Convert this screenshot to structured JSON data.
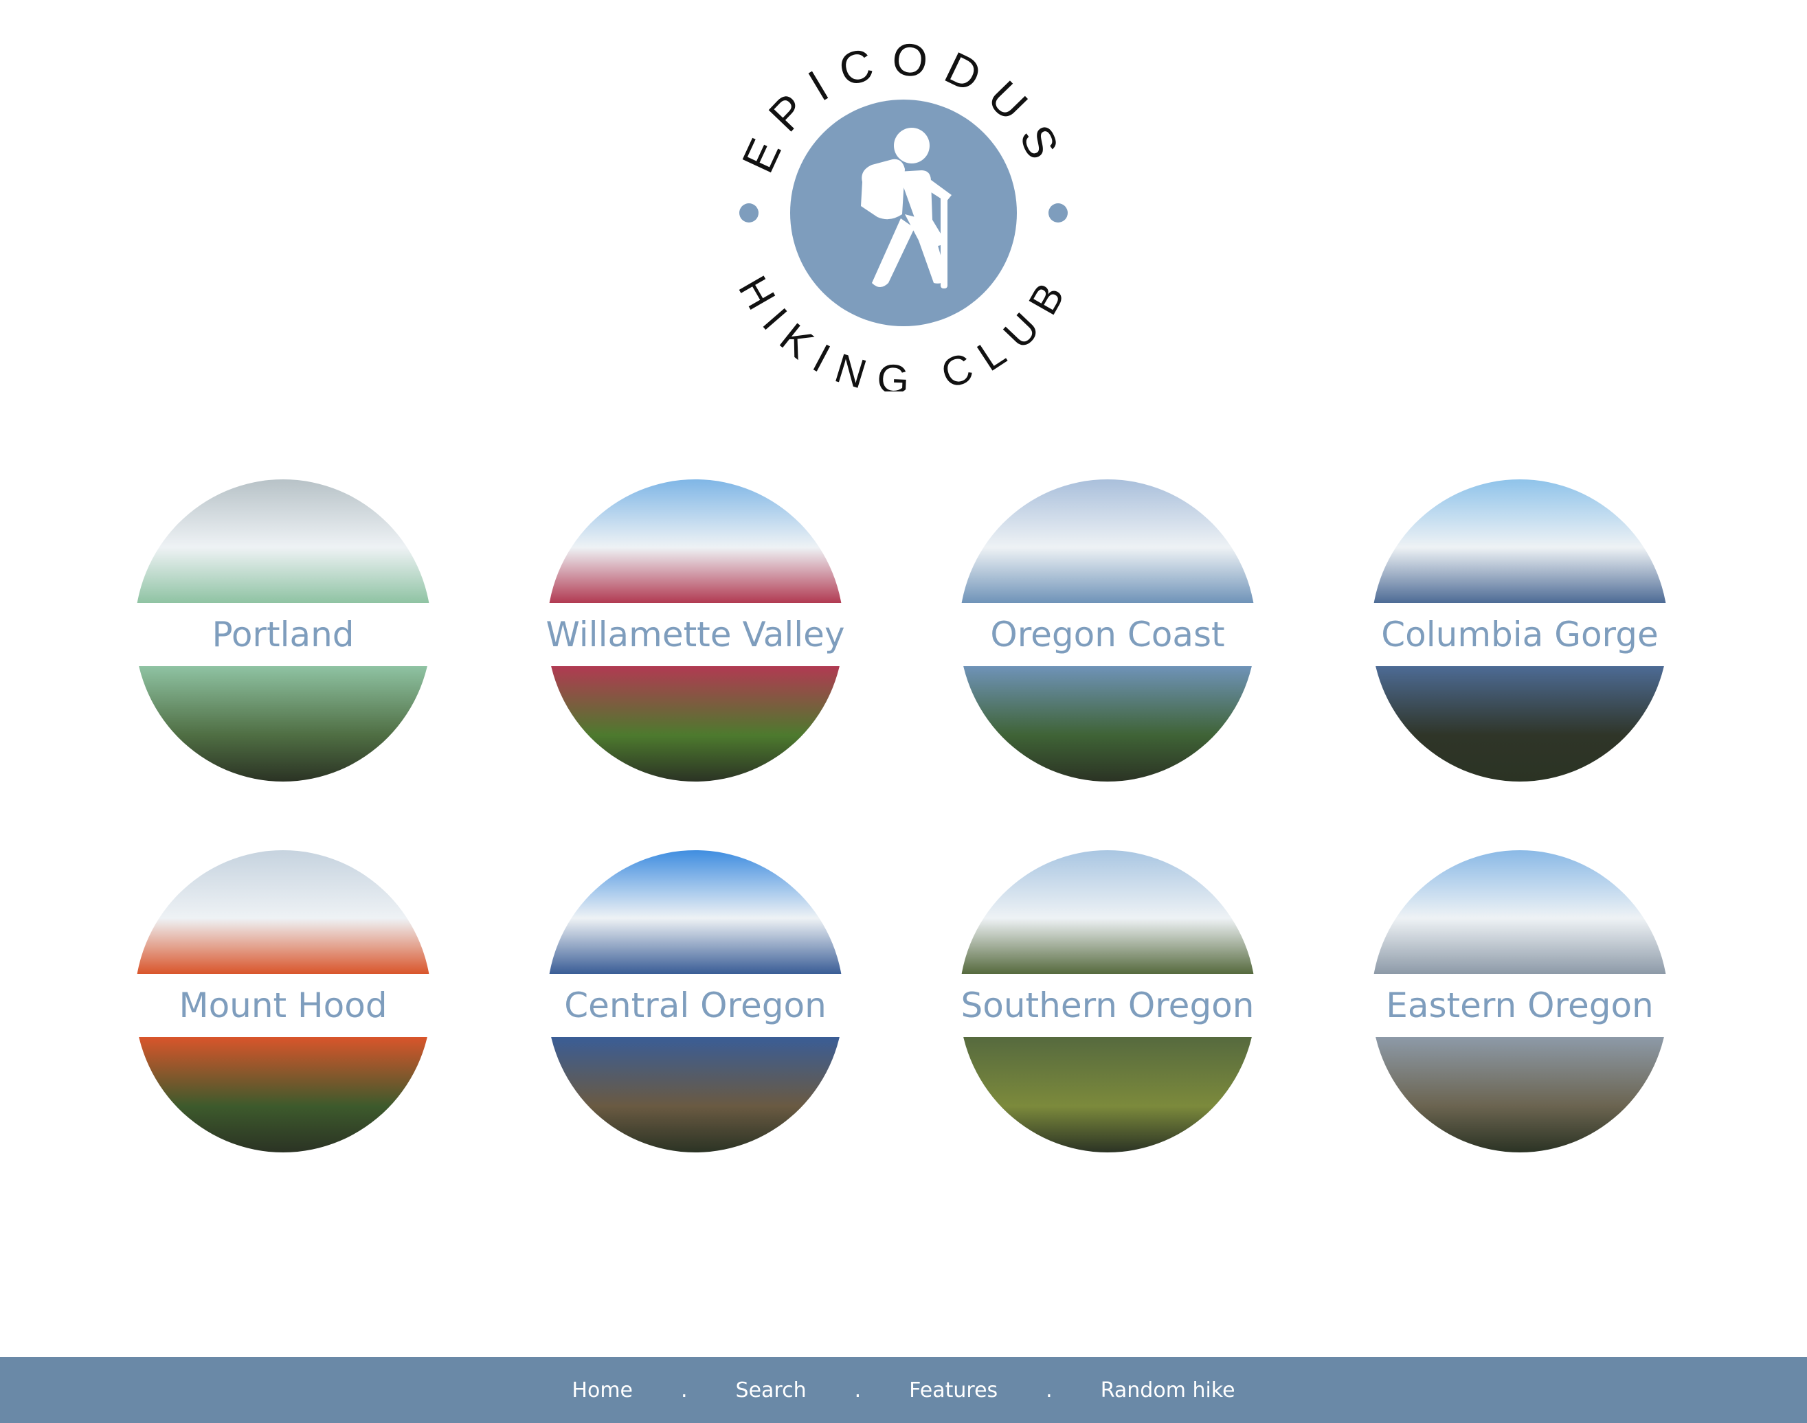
{
  "logo": {
    "text_top": "EPICODUS",
    "text_bottom": "HIKING CLUB",
    "badge_color": "#7e9dbd",
    "icon": "hiker-icon"
  },
  "regions": [
    {
      "label": "Portland",
      "sky": "#b7c2c7",
      "ground": "#4f6e43",
      "accent": "#8fc3a3"
    },
    {
      "label": "Willamette Valley",
      "sky": "#7fb6e6",
      "ground": "#4d7a2e",
      "accent": "#b13a52"
    },
    {
      "label": "Oregon Coast",
      "sky": "#a9bfdb",
      "ground": "#3f6336",
      "accent": "#6f93b8"
    },
    {
      "label": "Columbia Gorge",
      "sky": "#8fc3ea",
      "ground": "#2f3528",
      "accent": "#4d6b95"
    },
    {
      "label": "Mount Hood",
      "sky": "#c6d3df",
      "ground": "#3d5a2c",
      "accent": "#d9552b"
    },
    {
      "label": "Central Oregon",
      "sky": "#3f8de0",
      "ground": "#6a5a42",
      "accent": "#3a5d96"
    },
    {
      "label": "Southern Oregon",
      "sky": "#a9c6e2",
      "ground": "#7c8a3c",
      "accent": "#566a3e"
    },
    {
      "label": "Eastern Oregon",
      "sky": "#8ab9e6",
      "ground": "#6b6450",
      "accent": "#8d9aa8"
    }
  ],
  "footer": {
    "background": "#6a89a7",
    "links": [
      "Home",
      "Search",
      "Features",
      "Random hike"
    ],
    "separator": "."
  }
}
